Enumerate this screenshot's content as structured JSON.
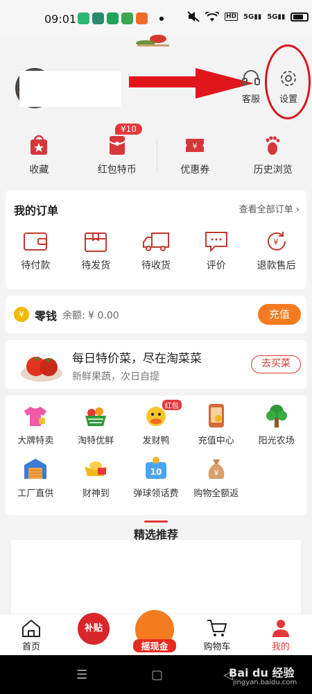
{
  "status_bar": {
    "time": "09:01",
    "network": "5G",
    "colors": {
      "bg": "#f6f6f6"
    }
  },
  "header": {
    "customer_service_label": "客服",
    "settings_label": "设置",
    "annotation_color": "#d8141b"
  },
  "shortcuts": [
    {
      "label": "收藏",
      "icon": "bag-star-icon"
    },
    {
      "label": "红包特币",
      "icon": "red-envelope-icon",
      "badge": "¥10"
    },
    {
      "label": "优惠券",
      "icon": "coupon-icon"
    },
    {
      "label": "历史浏览",
      "icon": "footprint-icon"
    }
  ],
  "orders": {
    "title": "我的订单",
    "view_all": "查看全部订单 ›",
    "items": [
      {
        "label": "待付款",
        "icon": "wallet-icon"
      },
      {
        "label": "待发货",
        "icon": "package-icon"
      },
      {
        "label": "待收货",
        "icon": "truck-icon"
      },
      {
        "label": "评价",
        "icon": "comment-icon"
      },
      {
        "label": "退款售后",
        "icon": "refund-icon"
      }
    ]
  },
  "wallet": {
    "coin_symbol": "¥",
    "title": "零钱",
    "balance": "余额: ¥ 0.00",
    "recharge_button": "充值"
  },
  "promo": {
    "title": "每日特价菜，尽在淘菜菜",
    "subtitle": "新鲜果蔬，次日自提",
    "button": "去买菜"
  },
  "services": [
    {
      "label": "大牌特卖",
      "icon": "tshirt-icon"
    },
    {
      "label": "淘特优鲜",
      "icon": "fruit-basket-icon"
    },
    {
      "label": "发财鸭",
      "icon": "duck-icon",
      "tag": "红包"
    },
    {
      "label": "充值中心",
      "icon": "phone-recharge-icon"
    },
    {
      "label": "阳光农场",
      "icon": "tree-icon"
    },
    {
      "label": "工厂直供",
      "icon": "factory-icon"
    },
    {
      "label": "财神到",
      "icon": "gold-ingot-icon"
    },
    {
      "label": "弹球领话费",
      "icon": "pinball-icon"
    },
    {
      "label": "购物全额返",
      "icon": "money-bag-icon"
    }
  ],
  "recommend": {
    "title": "精选推荐"
  },
  "tabbar": {
    "home": "首页",
    "subsidy": "补贴",
    "shake_cash": "摇现金",
    "cart": "购物车",
    "mine": "我的"
  },
  "watermark": {
    "brand": "Bai du 经验",
    "url": "jingyan.baidu.com"
  }
}
